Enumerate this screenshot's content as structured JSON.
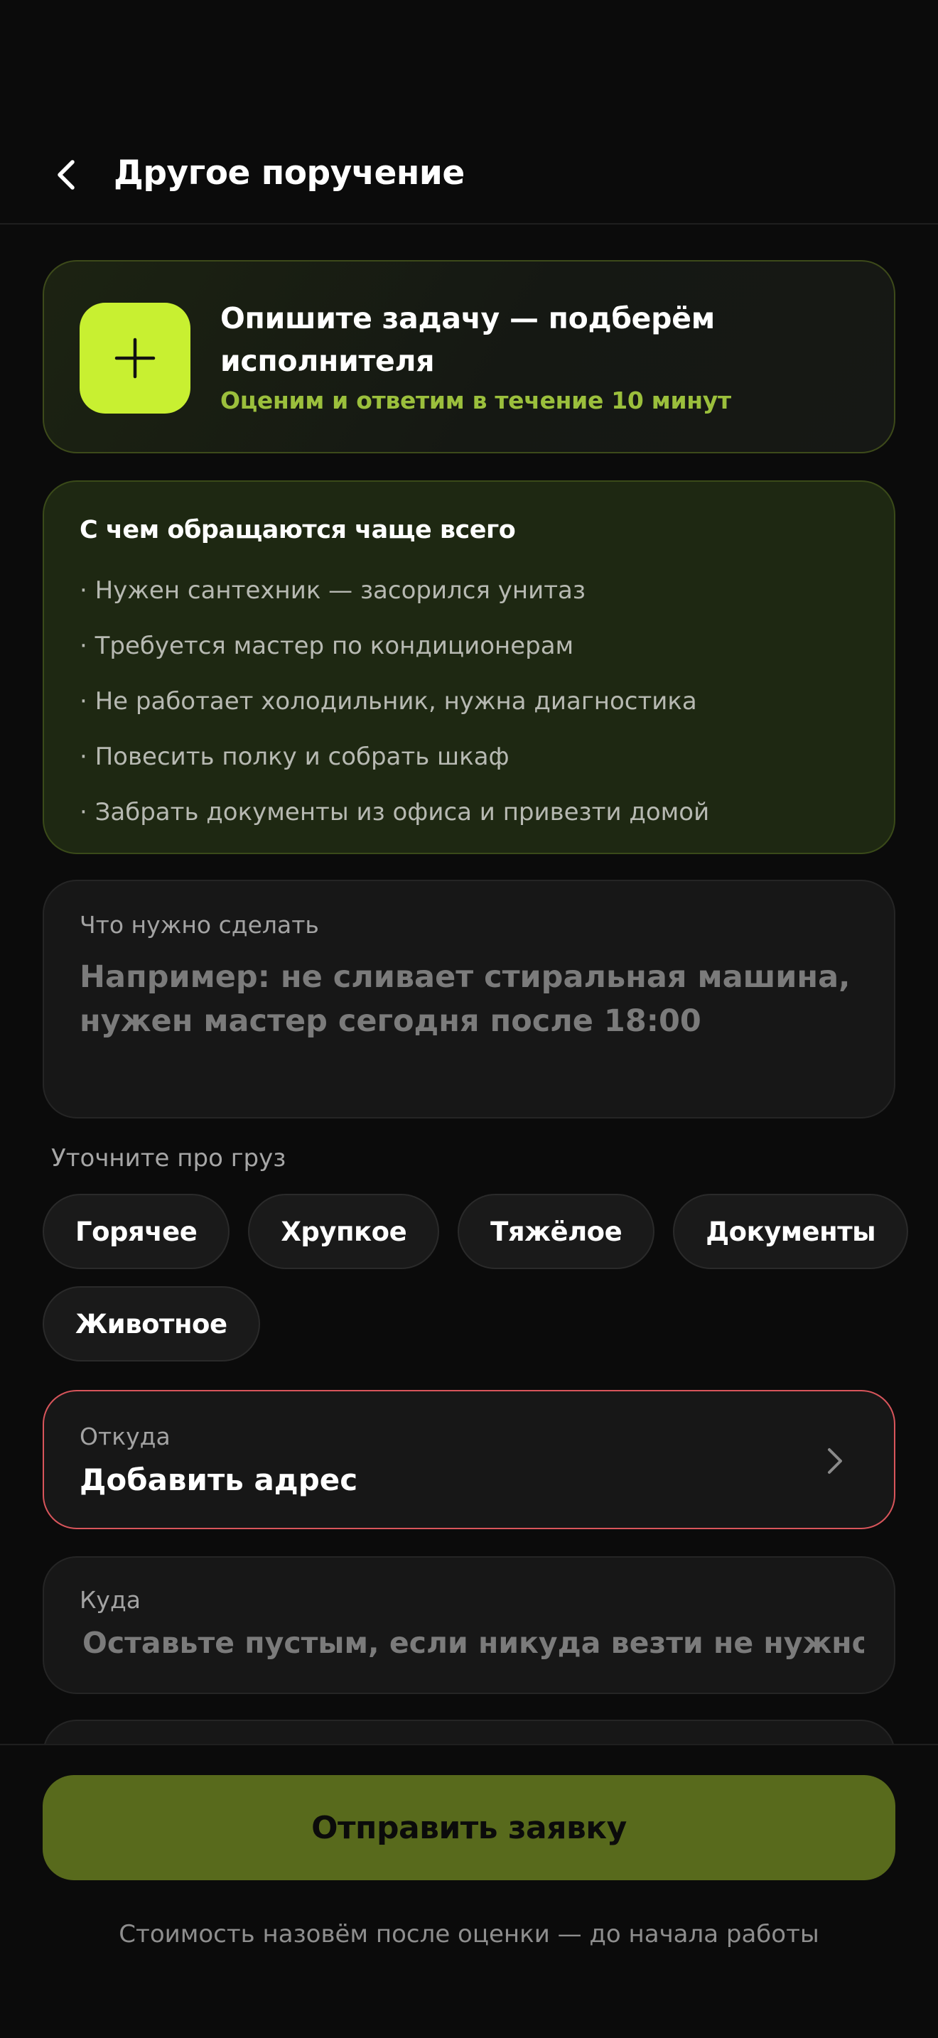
{
  "header": {
    "title": "Другое поручение"
  },
  "hero": {
    "title": "Опишите задачу — подберём исполнителя",
    "subtitle": "Оценим и ответим в течение 10 минут"
  },
  "popular": {
    "title": "С чем обращаются чаще всего",
    "items": [
      "· Нужен сантехник — засорился унитаз",
      "· Требуется мастер по кондиционерам",
      "· Не работает холодильник, нужна диагностика",
      "· Повесить полку и собрать шкаф",
      "· Забрать документы из офиса и привезти домой"
    ]
  },
  "task": {
    "label": "Что нужно сделать",
    "placeholder": "Например: не сливает стиральная машина, нужен мастер сегодня после 18:00",
    "value": ""
  },
  "cargo": {
    "label": "Уточните про груз",
    "chips": [
      "Горячее",
      "Хрупкое",
      "Тяжёлое",
      "Документы",
      "Животное"
    ]
  },
  "from": {
    "label": "Откуда",
    "value": "Добавить адрес"
  },
  "to": {
    "label": "Куда",
    "placeholder": "Оставьте пустым, если никуда везти не нужно"
  },
  "footer": {
    "submit_label": "Отправить заявку",
    "note": "Стоимость назовём после оценки — до начала работы"
  },
  "colors": {
    "accent": "#c8f031",
    "accent_text": "#9bbf3c",
    "submit_bg": "#586a1c",
    "error_border": "#d8555b",
    "background": "#0b0b0b"
  },
  "icons": {
    "back": "chevron-left-icon",
    "hero": "plus-icon",
    "from": "chevron-right-icon"
  }
}
